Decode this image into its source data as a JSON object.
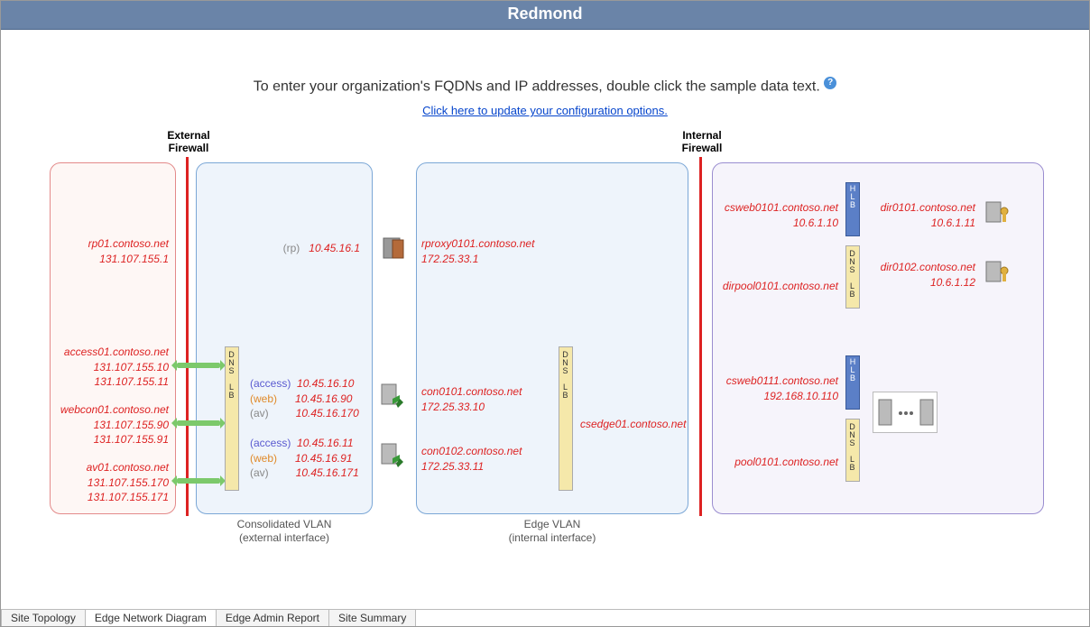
{
  "title": "Redmond",
  "instruction": "To enter your organization's FQDNs and IP addresses, double click the sample data text.",
  "config_link": "Click here to update your configuration options.",
  "labels": {
    "ext_fw": "External\nFirewall",
    "int_fw": "Internal\nFirewall",
    "vlan_ext_1": "Consolidated VLAN",
    "vlan_ext_2": "(external interface)",
    "vlan_int_1": "Edge VLAN",
    "vlan_int_2": "(internal interface)",
    "dns_lb": "DNS LB",
    "hlb": "HLB",
    "rp_lbl": "(rp)",
    "access_lbl": "(access)",
    "web_lbl": "(web)",
    "av_lbl": "(av)"
  },
  "external": {
    "rp": {
      "fqdn": "rp01.contoso.net",
      "ip": "131.107.155.1"
    },
    "access": {
      "fqdn": "access01.contoso.net",
      "ip1": "131.107.155.10",
      "ip2": "131.107.155.11"
    },
    "webcon": {
      "fqdn": "webcon01.contoso.net",
      "ip1": "131.107.155.90",
      "ip2": "131.107.155.91"
    },
    "av": {
      "fqdn": "av01.contoso.net",
      "ip1": "131.107.155.170",
      "ip2": "131.107.155.171"
    }
  },
  "consolidated": {
    "rp_ip": "10.45.16.1",
    "set1": {
      "access": "10.45.16.10",
      "web": "10.45.16.90",
      "av": "10.45.16.170"
    },
    "set2": {
      "access": "10.45.16.11",
      "web": "10.45.16.91",
      "av": "10.45.16.171"
    }
  },
  "edge": {
    "rproxy": {
      "fqdn": "rproxy0101.contoso.net",
      "ip": "172.25.33.1"
    },
    "con1": {
      "fqdn": "con0101.contoso.net",
      "ip": "172.25.33.10"
    },
    "con2": {
      "fqdn": "con0102.contoso.net",
      "ip": "172.25.33.11"
    },
    "csedge": "csedge01.contoso.net"
  },
  "internal": {
    "csweb1": {
      "fqdn": "csweb0101.contoso.net",
      "ip": "10.6.1.10"
    },
    "dirpool": "dirpool0101.contoso.net",
    "dir1": {
      "fqdn": "dir0101.contoso.net",
      "ip": "10.6.1.11"
    },
    "dir2": {
      "fqdn": "dir0102.contoso.net",
      "ip": "10.6.1.12"
    },
    "csweb2": {
      "fqdn": "csweb0111.contoso.net",
      "ip": "192.168.10.110"
    },
    "pool": "pool0101.contoso.net"
  },
  "tabs": [
    "Site Topology",
    "Edge Network Diagram",
    "Edge Admin Report",
    "Site Summary"
  ],
  "active_tab": 1
}
